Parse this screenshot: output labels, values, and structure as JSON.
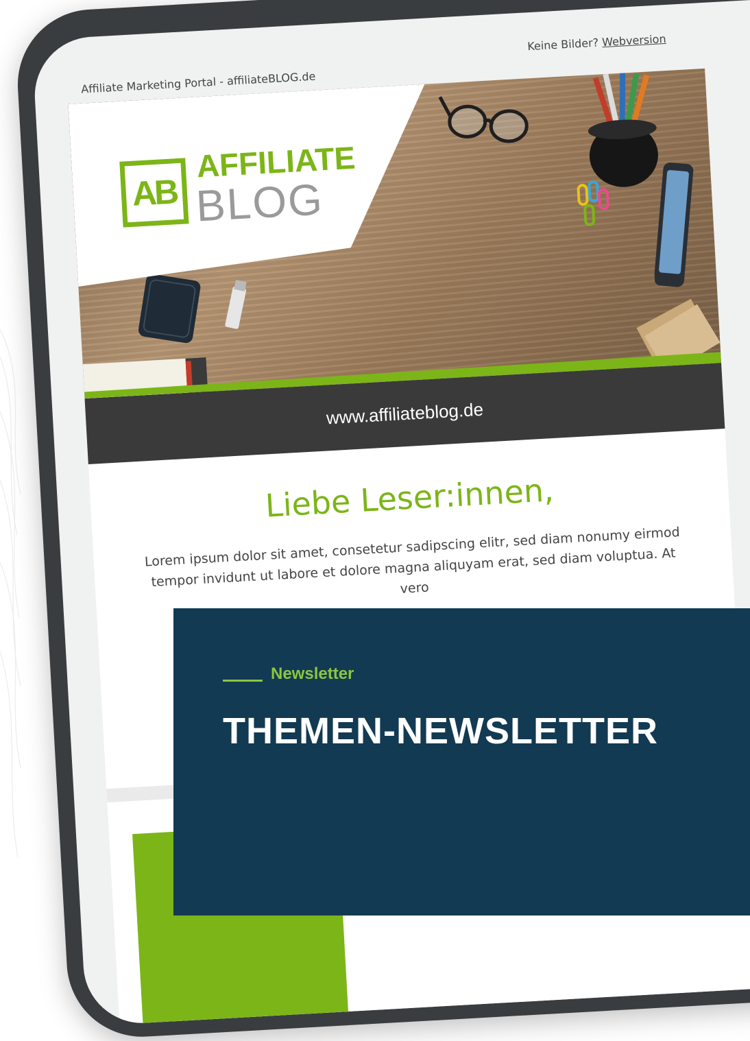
{
  "topbar": {
    "left_text": "Affiliate Marketing Portal - affiliateBLOG.de",
    "right_prefix": "Keine Bilder?",
    "right_link": "Webversion"
  },
  "logo": {
    "mark": "AB",
    "top": "AFFILIATE",
    "bottom": "BLOG"
  },
  "url": "www.affiliateblog.de",
  "greeting": "Liebe Leser:innen,",
  "body_text": "Lorem ipsum dolor sit amet, consetetur sadipscing elitr, sed diam nonumy eirmod tempor invidunt ut labore et dolore magna aliquyam erat, sed diam voluptua. At vero",
  "card": {
    "kicker": "Newsletter",
    "title": "THEMEN-NEWSLETTER"
  },
  "colors": {
    "brand_green": "#7cb518",
    "card_navy": "#123a52",
    "url_bar": "#3a3a3a"
  }
}
